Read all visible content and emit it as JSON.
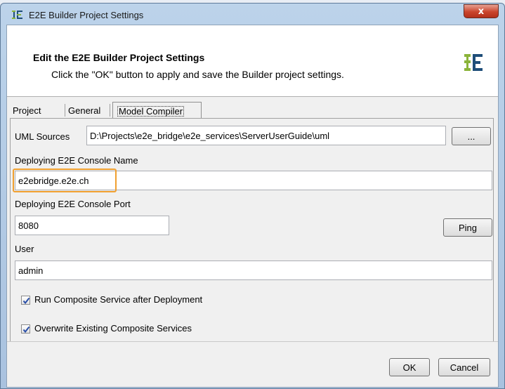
{
  "window": {
    "title": "E2E Builder Project Settings",
    "close_label": "x"
  },
  "header": {
    "title": "Edit the E2E Builder Project Settings",
    "subtitle": "Click the \"OK\" button to apply and save the Builder project settings.",
    "logo_icon": "e2e-logo-icon"
  },
  "tabs": [
    {
      "label": "Project",
      "active": false
    },
    {
      "label": "General",
      "active": false
    },
    {
      "label": "Model Compiler",
      "active": true
    }
  ],
  "form": {
    "uml_sources_label": "UML Sources",
    "uml_sources_value": "D:\\Projects\\e2e_bridge\\e2e_services\\ServerUserGuide\\uml",
    "browse_label": "...",
    "console_name_label": "Deploying E2E Console Name",
    "console_name_value": "e2ebridge.e2e.ch",
    "console_port_label": "Deploying E2E Console Port",
    "console_port_value": "8080",
    "ping_label": "Ping",
    "user_label": "User",
    "user_value": "admin",
    "run_after_deploy_label": "Run Composite Service after Deployment",
    "run_after_deploy_checked": true,
    "overwrite_label": "Overwrite Existing Composite Services",
    "overwrite_checked": true
  },
  "footer": {
    "ok_label": "OK",
    "cancel_label": "Cancel"
  },
  "colors": {
    "highlight": "#f0a030",
    "logo_green": "#8bb43a",
    "logo_blue": "#1f4e79",
    "close_red": "#c9442c"
  }
}
